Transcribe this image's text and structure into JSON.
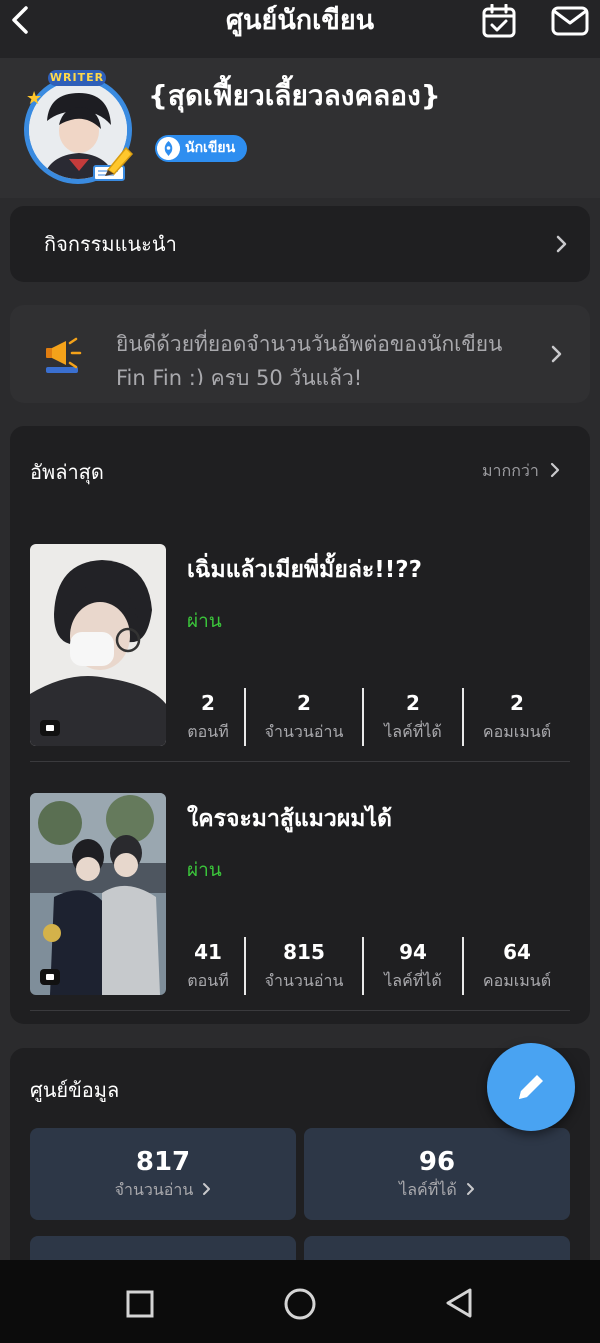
{
  "header": {
    "title": "ศูนย์นักเขียน"
  },
  "profile": {
    "badge_top": "WRITER",
    "username": "{สุดเฟี้ยวเลี้ยวลงคลอง}",
    "role": "นักเขียน"
  },
  "recommend": {
    "label": "กิจกรรมแนะนำ"
  },
  "announcement": {
    "text": "ยินดีด้วยที่ยอดจำนวนวันอัพต่อของนักเขียน Fin Fin :) ครบ 50 วันแล้ว!"
  },
  "latest": {
    "title": "อัพล่าสุด",
    "more": "มากกว่า",
    "stories": [
      {
        "name": "เฉิ่มแล้วเมียพี่มั้ยล่ะ!!??",
        "status": "ผ่าน",
        "stats": [
          {
            "value": "2",
            "label": "ตอนที"
          },
          {
            "value": "2",
            "label": "จำนวนอ่าน"
          },
          {
            "value": "2",
            "label": "ไลค์ที่ได้"
          },
          {
            "value": "2",
            "label": "คอมเมนต์"
          }
        ]
      },
      {
        "name": "ใครจะมาสู้แมวผมได้",
        "status": "ผ่าน",
        "stats": [
          {
            "value": "41",
            "label": "ตอนที"
          },
          {
            "value": "815",
            "label": "จำนวนอ่าน"
          },
          {
            "value": "94",
            "label": "ไลค์ที่ได้"
          },
          {
            "value": "64",
            "label": "คอมเมนต์"
          }
        ]
      }
    ]
  },
  "data_center": {
    "title": "ศูนย์ข้อมูล",
    "boxes": [
      {
        "value": "817",
        "label": "จำนวนอ่าน"
      },
      {
        "value": "96",
        "label": "ไลค์ที่ได้"
      }
    ]
  },
  "colors": {
    "accent": "#2e8ef0",
    "pass": "#3bc53b",
    "fab": "#49a3f2"
  },
  "icons": [
    "back-icon",
    "calendar-check-icon",
    "mail-icon",
    "megaphone-icon",
    "chevron-right-icon",
    "pencil-icon",
    "square-icon",
    "circle-icon",
    "triangle-back-icon"
  ]
}
